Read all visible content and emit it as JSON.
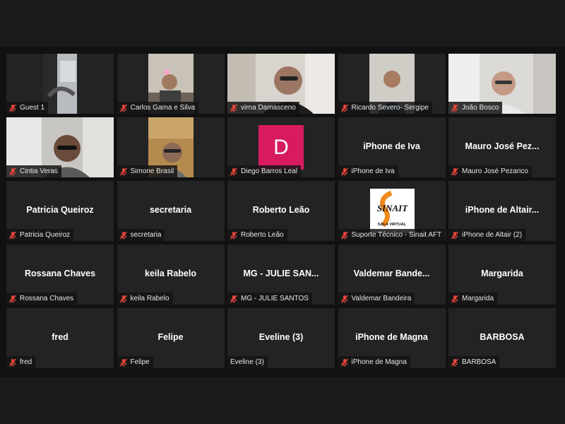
{
  "meeting": {
    "participants": [
      {
        "label": "Guest 1",
        "muted": true,
        "tile": "video",
        "scene": "car"
      },
      {
        "label": "Carlos Gama e Silva",
        "muted": true,
        "tile": "video",
        "scene": "man-room"
      },
      {
        "label": "virna Damasceno",
        "muted": true,
        "tile": "video",
        "scene": "woman-glasses"
      },
      {
        "label": "Ricardo Severo- Sergipe",
        "muted": true,
        "tile": "video",
        "scene": "man-wall"
      },
      {
        "label": "João Bosco",
        "muted": true,
        "tile": "video",
        "scene": "older-man"
      },
      {
        "label": "Cintia Veras",
        "muted": true,
        "tile": "video",
        "scene": "woman-window"
      },
      {
        "label": "Simone Brasil",
        "muted": true,
        "tile": "video",
        "scene": "child"
      },
      {
        "label": "Diego Barros Leal",
        "muted": true,
        "tile": "avatar",
        "avatar_letter": "D",
        "avatar_color": "#d81b60"
      },
      {
        "label": "iPhone de Iva",
        "display": "iPhone de Iva",
        "muted": true,
        "tile": "name"
      },
      {
        "label": "Mauro José Pezarico",
        "display": "Mauro José Pez...",
        "muted": true,
        "tile": "name"
      },
      {
        "label": "Patricia Queiroz",
        "display": "Patricia Queiroz",
        "muted": true,
        "tile": "name"
      },
      {
        "label": "secretaria",
        "display": "secretaria",
        "muted": true,
        "tile": "name"
      },
      {
        "label": "Roberto Leão",
        "display": "Roberto Leão",
        "muted": true,
        "tile": "name"
      },
      {
        "label": "Suporte Técnico - Sinait AFT",
        "muted": true,
        "tile": "logo",
        "logo_text": "SINAIT",
        "logo_sub": "SALA VIRTUAL"
      },
      {
        "label": "iPhone de Altair (2)",
        "display": "iPhone de Altair...",
        "muted": true,
        "tile": "name"
      },
      {
        "label": "Rossana Chaves",
        "display": "Rossana Chaves",
        "muted": true,
        "tile": "name"
      },
      {
        "label": "keila Rabelo",
        "display": "keila Rabelo",
        "muted": true,
        "tile": "name"
      },
      {
        "label": "MG - JULIE SANTOS",
        "display": "MG - JULIE SAN...",
        "muted": true,
        "tile": "name"
      },
      {
        "label": "Valdemar Bandeira",
        "display": "Valdemar Bande...",
        "muted": true,
        "tile": "name"
      },
      {
        "label": "Margarida",
        "display": "Margarida",
        "muted": true,
        "tile": "name"
      },
      {
        "label": "fred",
        "display": "fred",
        "muted": true,
        "tile": "name"
      },
      {
        "label": "Felipe",
        "display": "Felipe",
        "muted": true,
        "tile": "name"
      },
      {
        "label": "Eveline (3)",
        "display": "Eveline (3)",
        "muted": false,
        "tile": "name"
      },
      {
        "label": "iPhone de Magna",
        "display": "iPhone de Magna",
        "muted": true,
        "tile": "name"
      },
      {
        "label": "BARBOSA",
        "display": "BARBOSA",
        "muted": true,
        "tile": "name"
      }
    ]
  },
  "colors": {
    "background": "#1a1a1a",
    "tile": "#232323",
    "muted_icon": "#e8453c"
  }
}
